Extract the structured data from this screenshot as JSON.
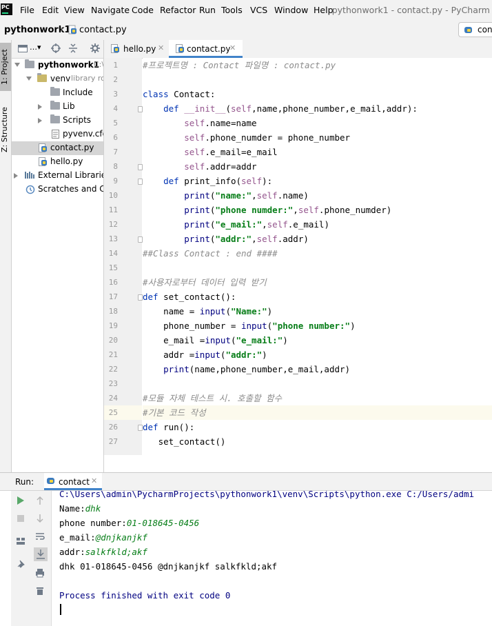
{
  "app": {
    "logo_text": "PC",
    "window_title": "pythonwork1 - contact.py - PyCharm"
  },
  "menu": [
    "File",
    "Edit",
    "View",
    "Navigate",
    "Code",
    "Refactor",
    "Run",
    "Tools",
    "VCS",
    "Window",
    "Help"
  ],
  "breadcrumb": {
    "project": "pythonwork1",
    "file": "contact.py",
    "run_config": "cont"
  },
  "tool_windows": {
    "project_tab": "1: Project",
    "structure_tab": "Z: Structure"
  },
  "project_tree": [
    {
      "label": "pythonwork1",
      "suffix": "C:\\",
      "type": "project"
    },
    {
      "label": "venv",
      "suffix": "library ro",
      "type": "folder"
    },
    {
      "label": "Include",
      "suffix": "",
      "type": "folder"
    },
    {
      "label": "Lib",
      "suffix": "",
      "type": "folder"
    },
    {
      "label": "Scripts",
      "suffix": "",
      "type": "folder"
    },
    {
      "label": "pyvenv.cfg",
      "suffix": "",
      "type": "file"
    },
    {
      "label": "contact.py",
      "suffix": "",
      "type": "py"
    },
    {
      "label": "hello.py",
      "suffix": "",
      "type": "py"
    },
    {
      "label": "External Libraries",
      "suffix": "",
      "type": "lib"
    },
    {
      "label": "Scratches and Co",
      "suffix": "",
      "type": "scratch"
    }
  ],
  "editor_tabs": [
    {
      "label": "hello.py",
      "active": false
    },
    {
      "label": "contact.py",
      "active": true
    }
  ],
  "code_lines": [
    {
      "n": "1",
      "html": "<span class=\"cmt\">#프로젝트명 : Contact 파일명 : contact.py</span>"
    },
    {
      "n": "2",
      "html": ""
    },
    {
      "n": "3",
      "html": "<span class=\"kw\">class</span> Contact:"
    },
    {
      "n": "4",
      "html": "    <span class=\"kw\">def</span> <span class=\"slf\">__init__</span>(<span class=\"slf\">self</span>,name,phone_number,e_mail,addr):"
    },
    {
      "n": "5",
      "html": "        <span class=\"slf\">self</span>.name=name"
    },
    {
      "n": "6",
      "html": "        <span class=\"slf\">self</span>.phone_numder = phone_number"
    },
    {
      "n": "7",
      "html": "        <span class=\"slf\">self</span>.e_mail=e_mail"
    },
    {
      "n": "8",
      "html": "        <span class=\"slf\">self</span>.addr=addr"
    },
    {
      "n": "9",
      "html": "    <span class=\"kw\">def</span> print_info(<span class=\"slf\">self</span>):"
    },
    {
      "n": "10",
      "html": "        <span class=\"bi\">print</span>(<span class=\"str\">\"name:\"</span>,<span class=\"slf\">self</span>.name)"
    },
    {
      "n": "11",
      "html": "        <span class=\"bi\">print</span>(<span class=\"str\">\"phone numder:\"</span>,<span class=\"slf\">self</span>.phone_numder)"
    },
    {
      "n": "12",
      "html": "        <span class=\"bi\">print</span>(<span class=\"str\">\"e_mail:\"</span>,<span class=\"slf\">self</span>.e_mail)"
    },
    {
      "n": "13",
      "html": "        <span class=\"bi\">print</span>(<span class=\"str\">\"addr:\"</span>,<span class=\"slf\">self</span>.addr)"
    },
    {
      "n": "14",
      "html": "<span class=\"cmt\">##Class Contact : end ####</span>"
    },
    {
      "n": "15",
      "html": ""
    },
    {
      "n": "16",
      "html": "<span class=\"cmt\">#사용자로부터 데이터 입력 받기</span>"
    },
    {
      "n": "17",
      "html": "<span class=\"kw\">def</span> set_contact():"
    },
    {
      "n": "18",
      "html": "    name = <span class=\"bi\">input</span>(<span class=\"str\">\"Name:\"</span>)"
    },
    {
      "n": "19",
      "html": "    phone_number = <span class=\"bi\">input</span>(<span class=\"str\">\"phone number:\"</span>)"
    },
    {
      "n": "20",
      "html": "    e_mail =<span class=\"bi\">input</span>(<span class=\"str\">\"e_mail:\"</span>)"
    },
    {
      "n": "21",
      "html": "    addr =<span class=\"bi\">input</span>(<span class=\"str\">\"addr:\"</span>)"
    },
    {
      "n": "22",
      "html": "    <span class=\"bi\">print</span>(name,phone_number,e_mail,addr)"
    },
    {
      "n": "23",
      "html": ""
    },
    {
      "n": "24",
      "html": "<span class=\"cmt\">#모듈 자체 테스트 시. 호출할 함수</span>"
    },
    {
      "n": "25",
      "html": "<span class=\"cmt\">#기본 코드 작성</span>",
      "current": true
    },
    {
      "n": "26",
      "html": "<span class=\"kw\">def</span> run():"
    },
    {
      "n": "27",
      "html": "   set_contact()"
    }
  ],
  "run_panel": {
    "label": "Run:",
    "tab": "contact",
    "output": [
      {
        "kind": "path",
        "text": "C:\\Users\\admin\\PycharmProjects\\pythonwork1\\venv\\Scripts\\python.exe C:/Users/admi"
      },
      {
        "kind": "prompt",
        "text": "Name:",
        "input": "dhk"
      },
      {
        "kind": "prompt",
        "text": "phone number:",
        "input": "01-018645-0456"
      },
      {
        "kind": "prompt",
        "text": "e_mail:",
        "input": "@dnjkanjkf"
      },
      {
        "kind": "prompt",
        "text": "addr:",
        "input": "salkfkld;akf"
      },
      {
        "kind": "plain",
        "text": "dhk 01-018645-0456 @dnjkanjkf salkfkld;akf"
      },
      {
        "kind": "blank",
        "text": ""
      },
      {
        "kind": "exit",
        "text": "Process finished with exit code 0"
      }
    ]
  },
  "colors": {
    "keyword": "#0033b3",
    "self": "#94558d",
    "string": "#067d17",
    "comment": "#8c8c8c",
    "accent": "#4083c9"
  }
}
